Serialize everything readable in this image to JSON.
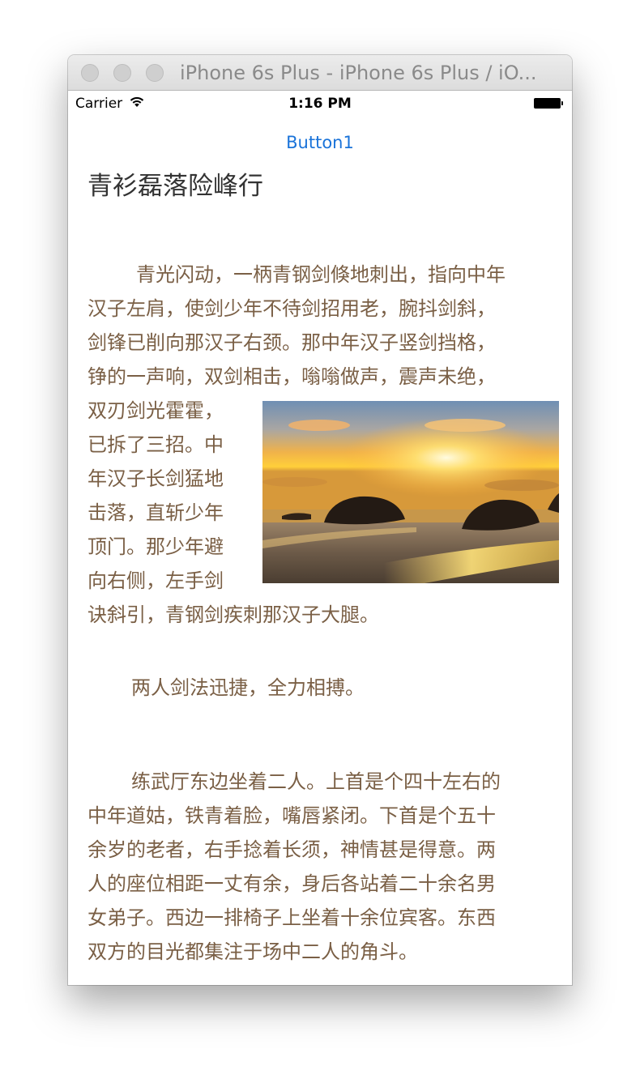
{
  "window": {
    "title": "iPhone 6s Plus - iPhone 6s Plus / iO..."
  },
  "status_bar": {
    "carrier": "Carrier",
    "time": "1:16 PM"
  },
  "nav": {
    "button_label": "Button1"
  },
  "article": {
    "title": "青衫磊落险峰行",
    "paragraph1_lines": [
      "青光闪动，一柄青钢剑倏地刺出，指向中年",
      "汉子左肩，使剑少年不待剑招用老，腕抖剑斜，",
      "剑锋已削向那汉子右颈。那中年汉子竖剑挡格，",
      "铮的一声响，双剑相击，嗡嗡做声，震声未绝，",
      "双刃剑光霍霍，",
      "已拆了三招。中",
      "年汉子长剑猛地",
      "击落，直斩少年",
      "顶门。那少年避",
      "向右侧，左手剑",
      "诀斜引，青钢剑疾刺那汉子大腿。"
    ],
    "paragraph2_lines": [
      "两人剑法迅捷，全力相搏。"
    ],
    "paragraph3_lines": [
      "练武厅东边坐着二人。上首是个四十左右的",
      "中年道姑，铁青着脸，嘴唇紧闭。下首是个五十",
      "余岁的老者，右手捻着长须，神情甚是得意。两",
      "人的座位相距一丈有余，身后各站着二十余名男",
      "女弟子。西边一排椅子上坐着十余位宾客。东西",
      "双方的目光都集注于场中二人的角斗。"
    ],
    "image": {
      "subject": "sunset over beach with rocks"
    }
  },
  "colors": {
    "link": "#1a73d9",
    "body_text": "#7a5f45",
    "heading_text": "#333333"
  }
}
